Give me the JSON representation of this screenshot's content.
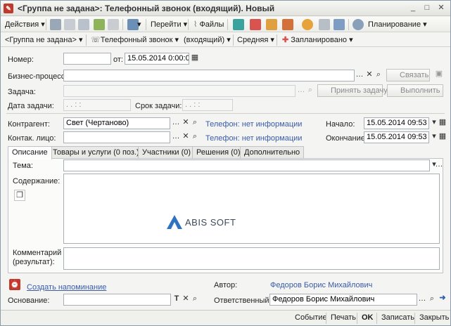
{
  "window": {
    "title": "<Группа не задана>: Телефонный звонок (входящий). Новый",
    "controls": [
      "_",
      "□",
      "✕"
    ]
  },
  "toolbar": {
    "actions": "Действия",
    "goto": "Перейти",
    "files": "Файлы",
    "planning": "Планирование"
  },
  "toolbar2": {
    "group": "<Группа не задана>",
    "type": "Телефонный звонок",
    "direction": "(входящий)",
    "priority": "Средняя",
    "state": "Запланировано"
  },
  "form": {
    "number_label": "Номер:",
    "number_value": "",
    "from_label": "от:",
    "from_value": "15.05.2014  0:00:00",
    "bp_label": "Бизнес-процесс:",
    "bp_value": "",
    "link_button": "Связать",
    "task_label": "Задача:",
    "task_value": "",
    "accept_button": "Принять задачу",
    "execute_button": "Выполнить",
    "task_date_label": "Дата задачи:",
    "task_date_value": ".  .     :  :",
    "deadline_label": "Срок задачи:",
    "deadline_value": ".  .     :  :",
    "contractor_label": "Контрагент:",
    "contractor_value": "Свет (Чертаново)",
    "contractor_phone": "Телефон: нет информации",
    "contact_label": "Контак. лицо:",
    "contact_value": "",
    "contact_phone": "Телефон: нет информации",
    "start_label": "Начало:",
    "start_value": "15.05.2014 09:53",
    "end_label": "Окончание:",
    "end_value": "15.05.2014 09:53"
  },
  "tabs": [
    {
      "label": "Описание"
    },
    {
      "label": "Товары и услуги (0 поз.)"
    },
    {
      "label": "Участники (0)"
    },
    {
      "label": "Решения (0)"
    },
    {
      "label": "Дополнительно"
    }
  ],
  "panel": {
    "theme_label": "Тема:",
    "theme_value": "",
    "content_label": "Содержание:",
    "logo_text": "ABIS SOFT",
    "comment_label": "Комментарий\n(результат):",
    "comment_value": ""
  },
  "bottom": {
    "reminder_link": "Создать напоминание",
    "author_label": "Автор:",
    "author_value": "Федоров Борис Михайлович",
    "basis_label": "Основание:",
    "basis_value": "",
    "responsible_label": "Ответственный:",
    "responsible_value": "Федоров Борис Михайлович"
  },
  "statusbar": {
    "event": "Событие",
    "print": "Печать",
    "ok": "OK",
    "save": "Записать",
    "close": "Закрыть"
  },
  "colors": {
    "link": "#3a5ba8",
    "logo_blue": "#2f73c0"
  }
}
